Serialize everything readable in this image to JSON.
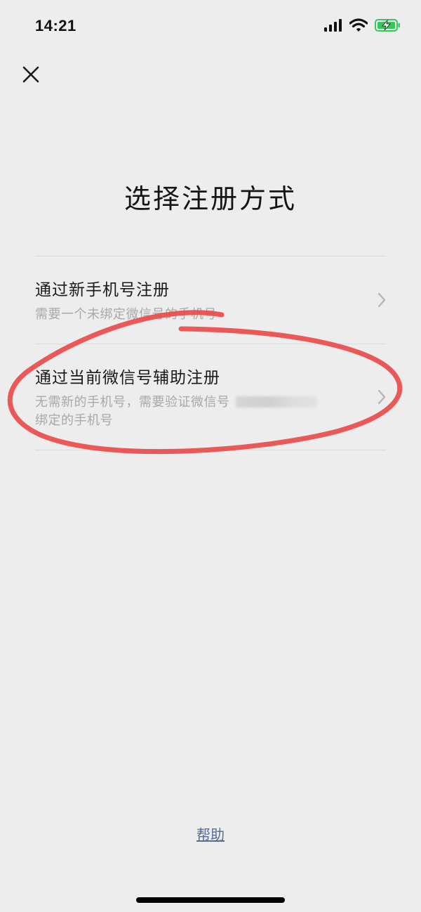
{
  "status_bar": {
    "time": "14:21",
    "icons": [
      "signal-icon",
      "wifi-icon",
      "battery-charging-icon"
    ],
    "battery_color": "#34c759"
  },
  "header": {
    "close_icon": "close-icon",
    "title": "选择注册方式"
  },
  "options": [
    {
      "title": "通过新手机号注册",
      "description": "需要一个未绑定微信号的手机号",
      "icon": "chevron-right-icon"
    },
    {
      "title": "通过当前微信号辅助注册",
      "description_line1": "无需新的手机号，需要验证微信号",
      "description_line2": "绑定的手机号",
      "icon": "chevron-right-icon"
    }
  ],
  "annotation": {
    "color": "#e94b4b"
  },
  "footer": {
    "help_label": "帮助",
    "link_color": "#576b95"
  }
}
